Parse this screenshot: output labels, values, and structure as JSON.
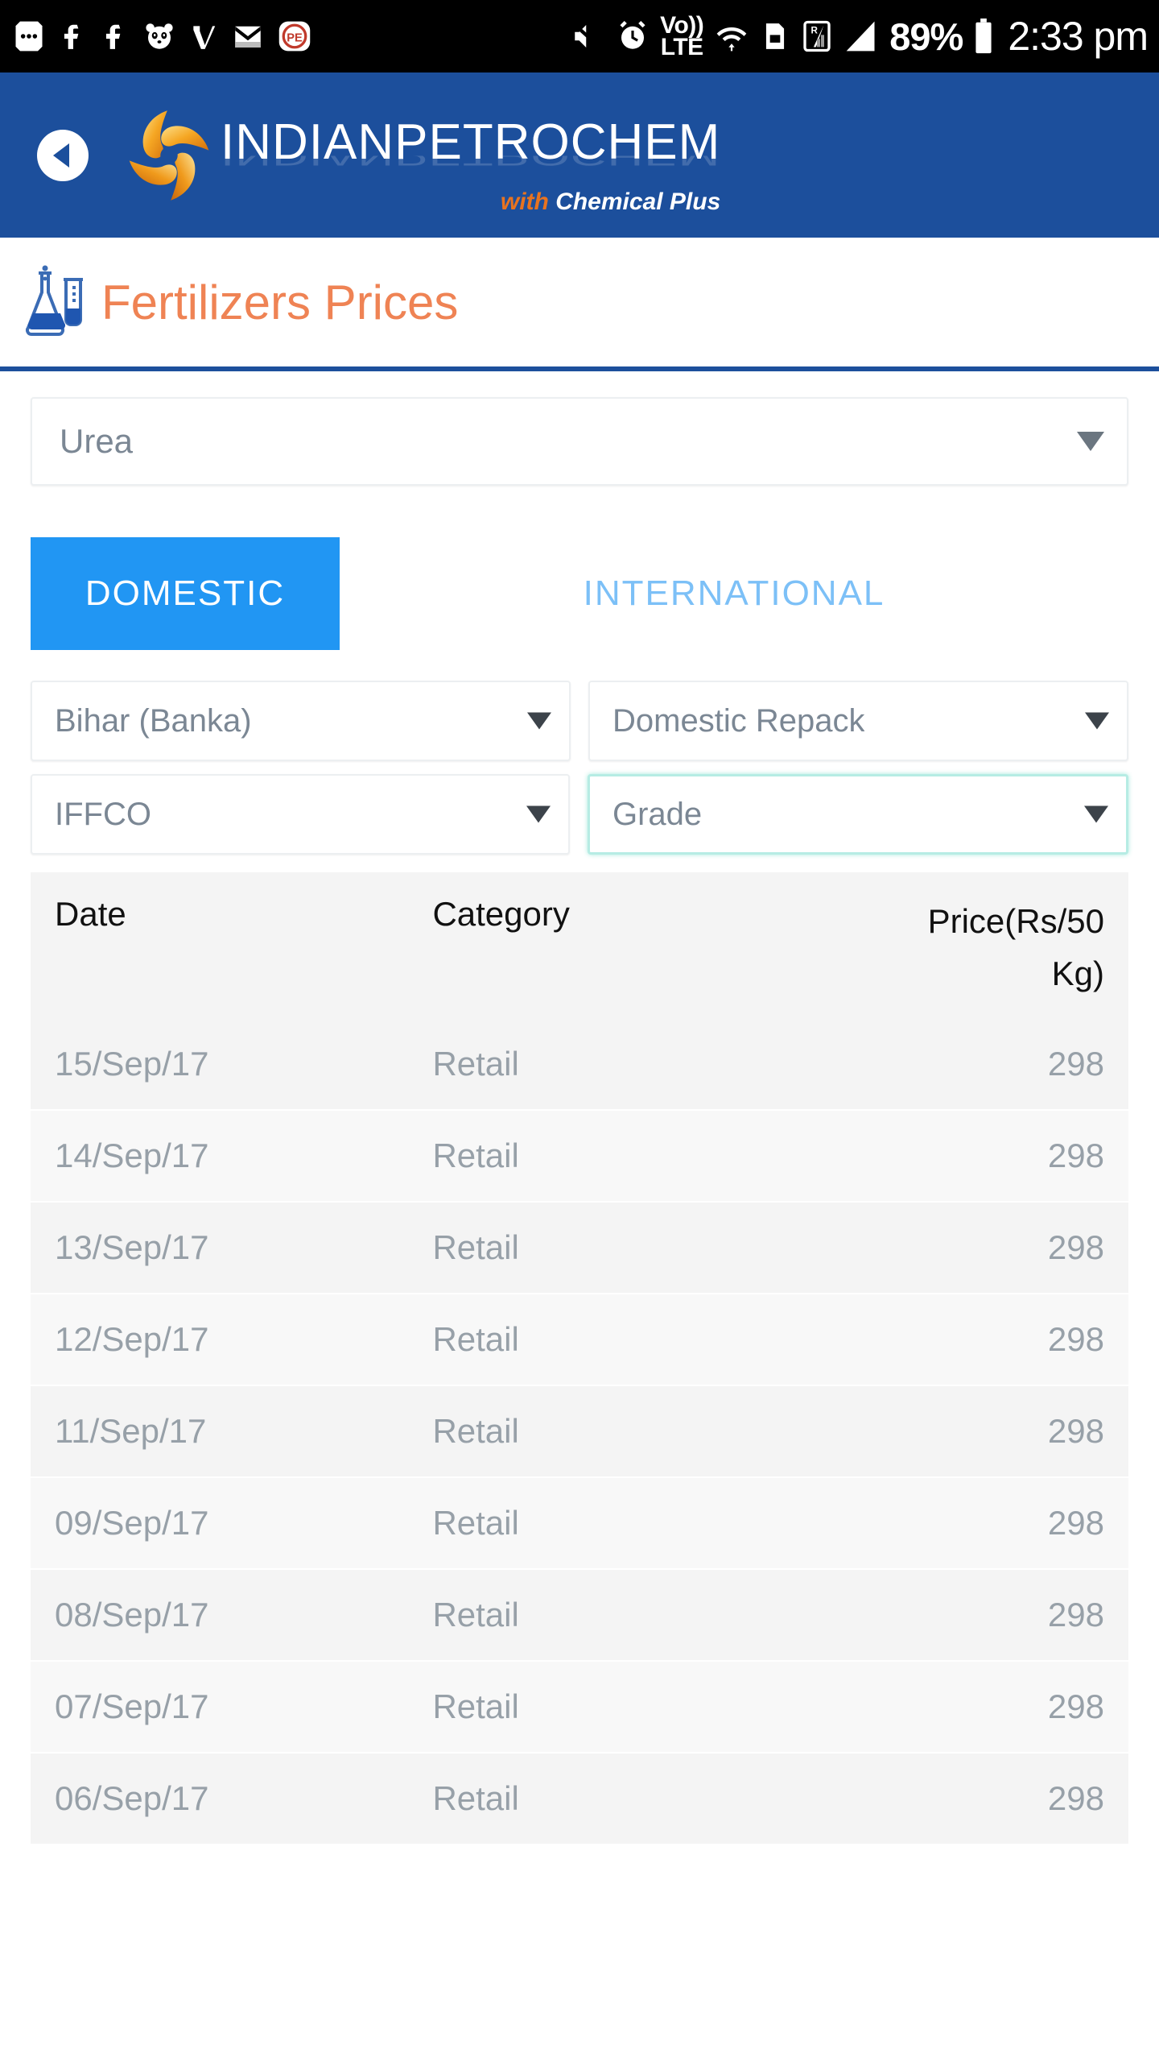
{
  "statusbar": {
    "left_icons": [
      "more-dots-icon",
      "facebook-icon",
      "facebook-icon",
      "panda-icon",
      "checkmark-icon",
      "gmail-icon",
      "pe-app-icon"
    ],
    "right_icons": [
      "mute-icon",
      "alarm-icon",
      "volte-icon",
      "wifi-icon",
      "sd-card-icon",
      "roaming-signal-icon",
      "signal-bars-icon"
    ],
    "volte_label": "Vo))",
    "volte_sub": "LTE",
    "roaming_label": "R",
    "battery_percent": "89%",
    "clock": "2:33 pm"
  },
  "header": {
    "back_label": "back-arrow",
    "brand": "INDIANPETROCHEM",
    "tagline_prefix": "with ",
    "tagline_main": "Chemical Plus",
    "background_color": "#1c4f9c"
  },
  "page": {
    "title": "Fertilizers Prices",
    "title_color": "#ef8354",
    "rule_color": "#1c4f9c"
  },
  "product_select": {
    "value": "Urea"
  },
  "tabs": [
    {
      "label": "DOMESTIC",
      "active": true
    },
    {
      "label": "INTERNATIONAL",
      "active": false
    }
  ],
  "tab_colors": {
    "active_bg": "#2196f3",
    "active_text": "#ffffff",
    "inactive_text": "#7cc0f7"
  },
  "filters": [
    {
      "name": "region",
      "value": "Bihar (Banka)",
      "focused": false
    },
    {
      "name": "packaging",
      "value": "Domestic Repack",
      "focused": false
    },
    {
      "name": "brand",
      "value": "IFFCO",
      "focused": false
    },
    {
      "name": "grade",
      "value": "Grade",
      "focused": true
    }
  ],
  "table": {
    "headers": [
      "Date",
      "Category",
      "Price(Rs/50 Kg)"
    ],
    "price_header_line1": "Price(Rs/50",
    "price_header_line2": "Kg)",
    "rows": [
      {
        "date": "15/Sep/17",
        "category": "Retail",
        "price": "298"
      },
      {
        "date": "14/Sep/17",
        "category": "Retail",
        "price": "298"
      },
      {
        "date": "13/Sep/17",
        "category": "Retail",
        "price": "298"
      },
      {
        "date": "12/Sep/17",
        "category": "Retail",
        "price": "298"
      },
      {
        "date": "11/Sep/17",
        "category": "Retail",
        "price": "298"
      },
      {
        "date": "09/Sep/17",
        "category": "Retail",
        "price": "298"
      },
      {
        "date": "08/Sep/17",
        "category": "Retail",
        "price": "298"
      },
      {
        "date": "07/Sep/17",
        "category": "Retail",
        "price": "298"
      },
      {
        "date": "06/Sep/17",
        "category": "Retail",
        "price": "298"
      }
    ]
  }
}
